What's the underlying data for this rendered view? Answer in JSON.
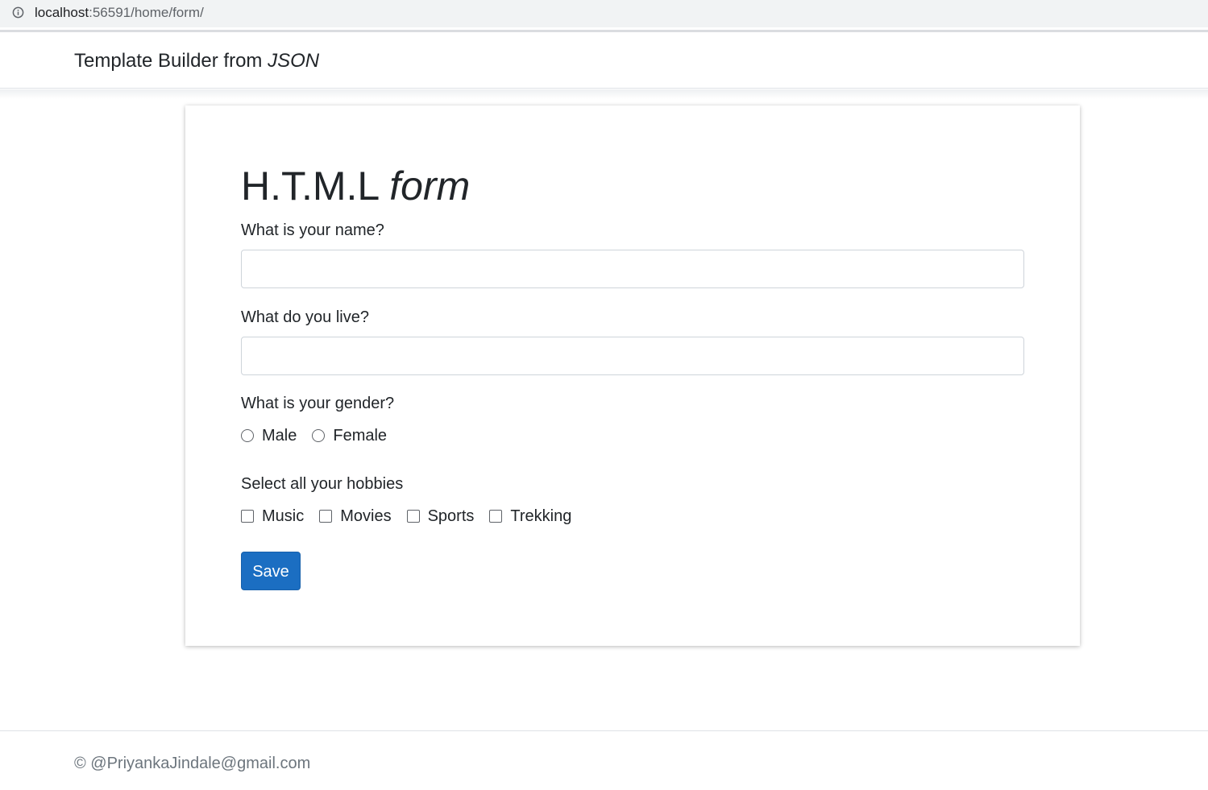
{
  "browser": {
    "url_host": "localhost",
    "url_path": ":56591/home/form/",
    "info_icon": "info-icon"
  },
  "navbar": {
    "brand_prefix": "Template Builder from ",
    "brand_emphasis": "JSON"
  },
  "form": {
    "title_prefix": "H.T.M.L ",
    "title_emphasis": "form",
    "name_label": "What is your name?",
    "name_value": "",
    "live_label": "What do you live?",
    "live_value": "",
    "gender_label": "What is your gender?",
    "gender_options": [
      "Male",
      "Female"
    ],
    "hobbies_label": "Select all your hobbies",
    "hobby_options": [
      "Music",
      "Movies",
      "Sports",
      "Trekking"
    ],
    "save_label": "Save"
  },
  "footer": {
    "copyright": "© @PriyankaJindale@gmail.com"
  },
  "colors": {
    "primary_button": "#1b6ec2",
    "text": "#212529",
    "muted_text": "#6c757d"
  }
}
